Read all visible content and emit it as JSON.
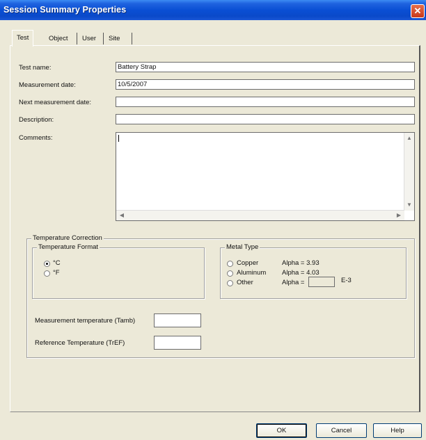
{
  "window": {
    "title": "Session Summary Properties"
  },
  "tabs": [
    "Test",
    "Object",
    "User",
    "Site"
  ],
  "fields": {
    "test_name": {
      "label": "Test name:",
      "value": "Battery Strap"
    },
    "measurement_date": {
      "label": "Measurement date:",
      "value": "10/5/2007"
    },
    "next_measurement_date": {
      "label": "Next measurement date:",
      "value": ""
    },
    "description": {
      "label": "Description:",
      "value": ""
    },
    "comments": {
      "label": "Comments:",
      "value": ""
    }
  },
  "temperature_correction": {
    "title": "Temperature Correction",
    "format": {
      "title": "Temperature Format",
      "options": [
        "°C",
        "°F"
      ],
      "selected": "°C"
    },
    "metal": {
      "title": "Metal Type",
      "options": [
        {
          "name": "Copper",
          "alpha": "Alpha = 3.93"
        },
        {
          "name": "Aluminum",
          "alpha": "Alpha = 4.03"
        },
        {
          "name": "Other",
          "alpha": "Alpha ="
        }
      ],
      "exponent": "E-3"
    },
    "measurement_temperature": {
      "label": "Measurement temperature (Tamb)",
      "value": ""
    },
    "reference_temperature": {
      "label": "Reference Temperature (TrEF)",
      "value": ""
    }
  },
  "buttons": {
    "ok": "OK",
    "cancel": "Cancel",
    "help": "Help"
  }
}
